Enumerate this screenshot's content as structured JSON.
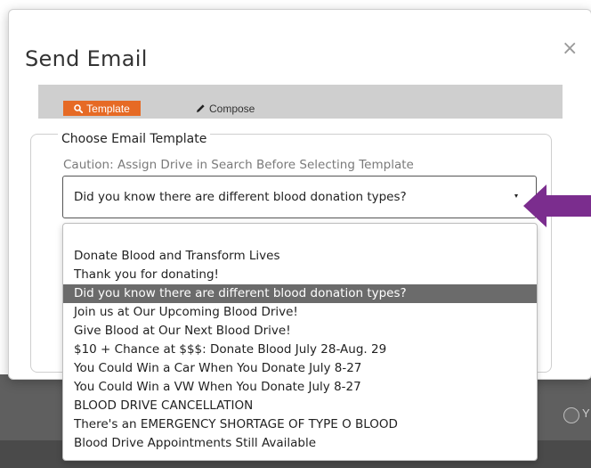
{
  "modal": {
    "title": "Send Email",
    "close_label": "×"
  },
  "tabs": [
    {
      "label": "Template",
      "icon": "search-icon",
      "active": true
    },
    {
      "label": "Compose",
      "icon": "pencil-icon",
      "active": false
    }
  ],
  "template_section": {
    "legend": "Choose Email Template",
    "caution": "Caution: Assign Drive in Search Before Selecting Template",
    "selected_value": "Did you know there are different blood donation types?"
  },
  "dropdown_options": [
    "Donate Blood and Transform Lives",
    "Thank you for donating!",
    "Did you know there are different blood donation types?",
    "Join us at Our Upcoming Blood Drive!",
    "Give Blood at Our Next Blood Drive!",
    "$10 + Chance at $$$: Donate Blood July 28-Aug. 29",
    "You Could Win a Car When You Donate July 8-27",
    "You Could Win a VW When You Donate July 8-27",
    "BLOOD DRIVE CANCELLATION",
    "There's an EMERGENCY SHORTAGE OF TYPE O BLOOD",
    "Blood Drive Appointments Still Available"
  ],
  "selected_option_index": 2,
  "background": {
    "radio_text": "Y"
  },
  "colors": {
    "accent_orange": "#e66a25",
    "arrow_purple": "#7b2d8e",
    "selected_bg": "#6b6b6b",
    "tabbar_bg": "#cfcfcf"
  }
}
